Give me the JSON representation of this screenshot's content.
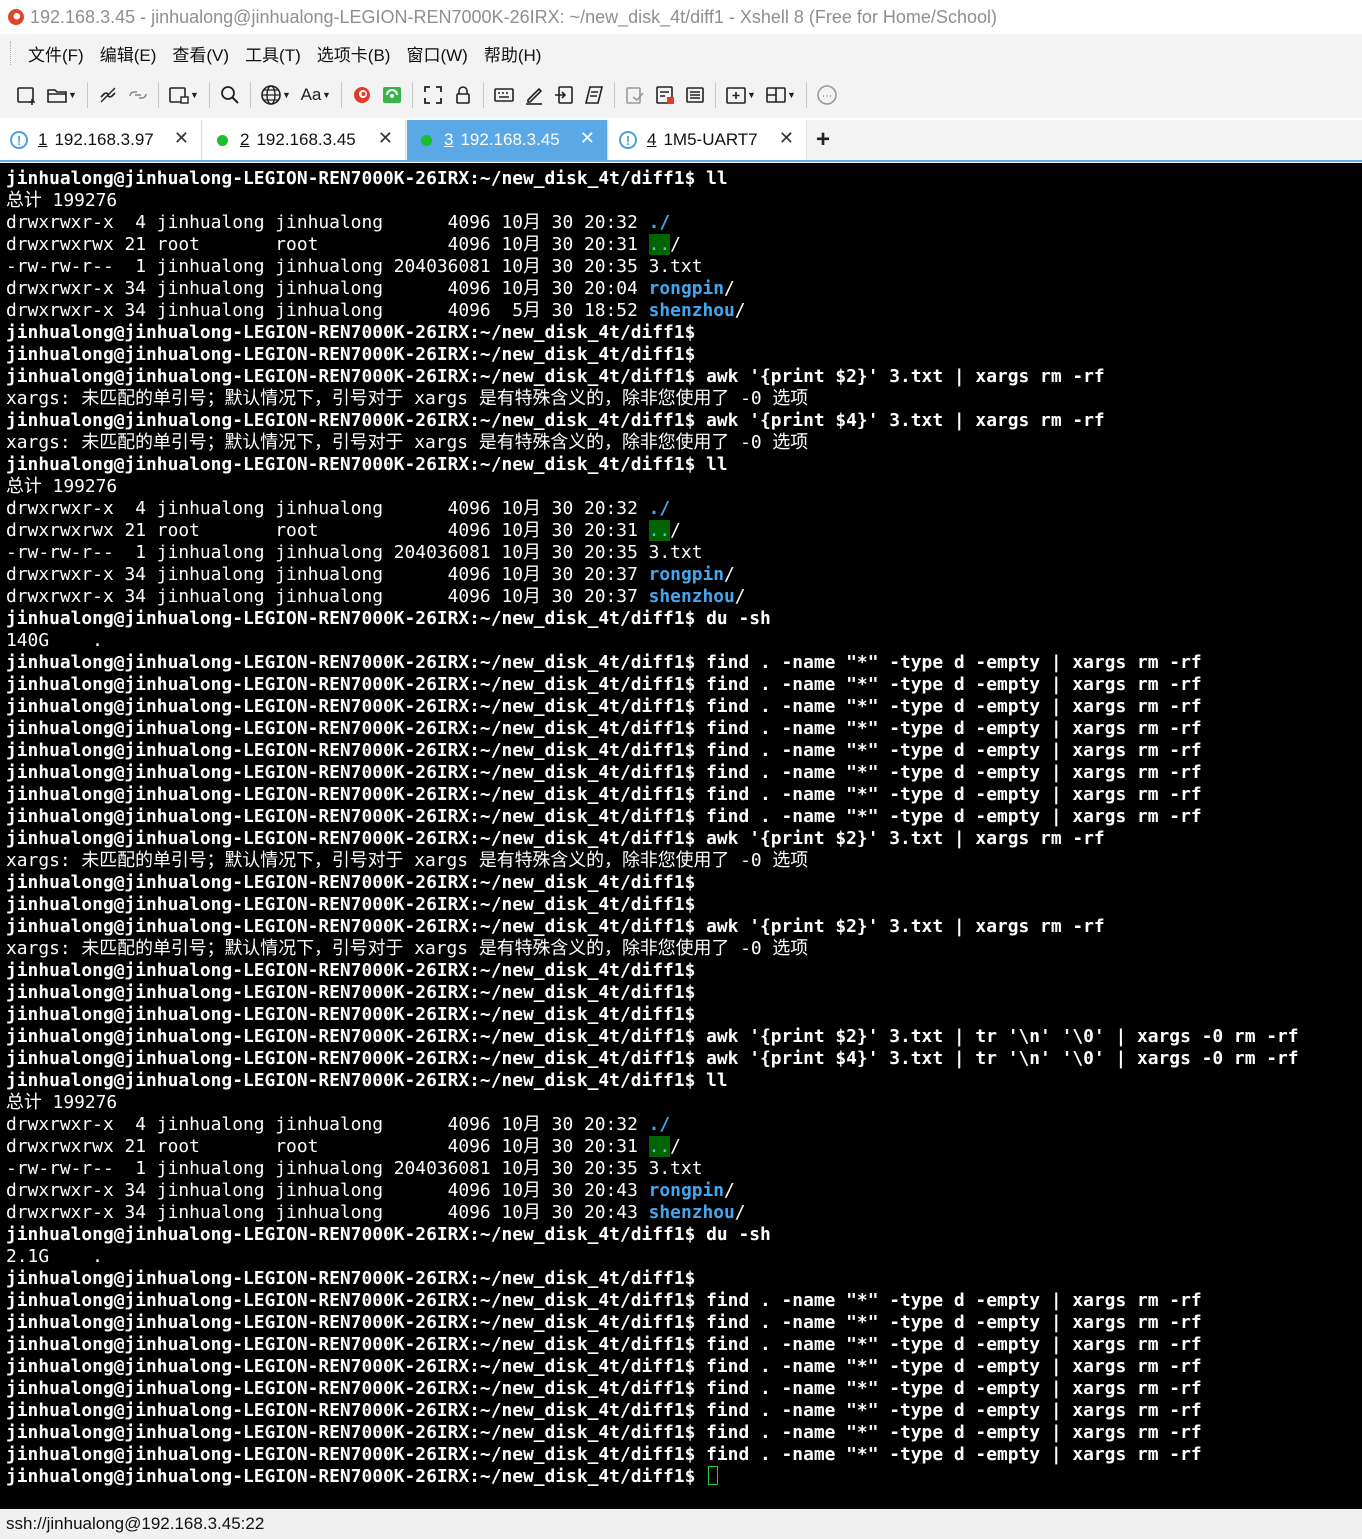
{
  "window": {
    "title": "192.168.3.45 - jinhualong@jinhualong-LEGION-REN7000K-26IRX: ~/new_disk_4t/diff1 - Xshell 8 (Free for Home/School)"
  },
  "menu": {
    "items": [
      "文件(F)",
      "编辑(E)",
      "查看(V)",
      "工具(T)",
      "选项卡(B)",
      "窗口(W)",
      "帮助(H)"
    ]
  },
  "toolbar": {
    "font_label": "Aa"
  },
  "tabs": [
    {
      "num": "1",
      "label": "192.168.3.97",
      "status": "warning",
      "active": false
    },
    {
      "num": "2",
      "label": "192.168.3.45",
      "status": "connected",
      "active": false
    },
    {
      "num": "3",
      "label": "192.168.3.45",
      "status": "connected",
      "active": true
    },
    {
      "num": "4",
      "label": "1M5-UART7",
      "status": "warning",
      "active": false
    }
  ],
  "tab_close_glyph": "✕",
  "tab_add_glyph": "+",
  "terminal": {
    "prompt": "jinhualong@jinhualong-LEGION-REN7000K-26IRX:~/new_disk_4t/diff1$",
    "cmd_ll": "ll",
    "cmd_du": "du -sh",
    "cmd_find": "find . -name \"*\" -type d -empty | xargs rm -rf",
    "cmd_awk2": "awk '{print $2}' 3.txt | xargs rm -rf",
    "cmd_awk4": "awk '{print $4}' 3.txt | xargs rm -rf",
    "cmd_awk2_tr": "awk '{print $2}' 3.txt | tr '\\n' '\\0' | xargs -0 rm -rf",
    "cmd_awk4_tr": "awk '{print $4}' 3.txt | tr '\\n' '\\0' | xargs -0 rm -rf",
    "xargs_error": "xargs: 未匹配的单引号；默认情况下，引号对于 xargs 是有特殊含义的，除非您使用了 -0 选项",
    "total": "总计 199276",
    "du_1": "140G\t.",
    "du_2": "2.1G\t.",
    "listing_1": {
      "cur_prefix": "drwxrwxr-x  4 jinhualong jinhualong      4096 10月 30 20:32 ",
      "cur_name": "./",
      "par_prefix": "drwxrwxrwx 21 root       root            4096 10月 30 20:31 ",
      "par_name": "..",
      "par_suffix": "/",
      "file": "-rw-rw-r--  1 jinhualong jinhualong 204036081 10月 30 20:35 3.txt",
      "d1_prefix": "drwxrwxr-x 34 jinhualong jinhualong      4096 10月 30 20:04 ",
      "d1_name": "rongpin",
      "d1_suffix": "/",
      "d2_prefix": "drwxrwxr-x 34 jinhualong jinhualong      4096  5月 30 18:52 ",
      "d2_name": "shenzhou",
      "d2_suffix": "/"
    },
    "listing_2": {
      "cur_prefix": "drwxrwxr-x  4 jinhualong jinhualong      4096 10月 30 20:32 ",
      "cur_name": "./",
      "par_prefix": "drwxrwxrwx 21 root       root            4096 10月 30 20:31 ",
      "par_name": "..",
      "par_suffix": "/",
      "file": "-rw-rw-r--  1 jinhualong jinhualong 204036081 10月 30 20:35 3.txt",
      "d1_prefix": "drwxrwxr-x 34 jinhualong jinhualong      4096 10月 30 20:37 ",
      "d1_name": "rongpin",
      "d1_suffix": "/",
      "d2_prefix": "drwxrwxr-x 34 jinhualong jinhualong      4096 10月 30 20:37 ",
      "d2_name": "shenzhou",
      "d2_suffix": "/"
    },
    "listing_3": {
      "cur_prefix": "drwxrwxr-x  4 jinhualong jinhualong      4096 10月 30 20:32 ",
      "cur_name": "./",
      "par_prefix": "drwxrwxrwx 21 root       root            4096 10月 30 20:31 ",
      "par_name": "..",
      "par_suffix": "/",
      "file": "-rw-rw-r--  1 jinhualong jinhualong 204036081 10月 30 20:35 3.txt",
      "d1_prefix": "drwxrwxr-x 34 jinhualong jinhualong      4096 10月 30 20:43 ",
      "d1_name": "rongpin",
      "d1_suffix": "/",
      "d2_prefix": "drwxrwxr-x 34 jinhualong jinhualong      4096 10月 30 20:43 ",
      "d2_name": "shenzhou",
      "d2_suffix": "/"
    }
  },
  "status": {
    "connection": "ssh://jinhualong@192.168.3.45:22"
  }
}
